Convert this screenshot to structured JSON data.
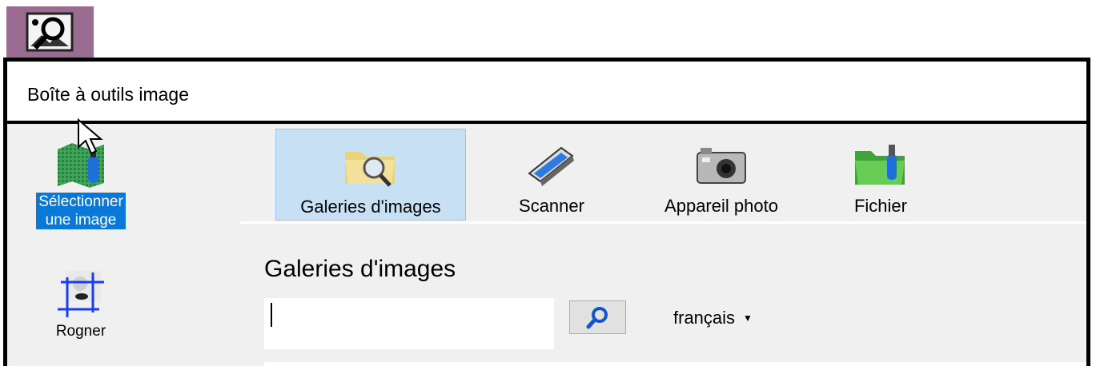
{
  "app": {
    "icon": "image-toolbox-app-icon",
    "accent": "#9b6c91"
  },
  "window": {
    "title": "Boîte à outils image"
  },
  "sidebar": {
    "items": [
      {
        "label_line1": "Sélectionner",
        "label_line2": "une image",
        "icon": "select-image-icon",
        "selected": true
      },
      {
        "label": "Rogner",
        "icon": "crop-icon",
        "selected": false
      }
    ],
    "selected_color": "#0a78d7"
  },
  "tabs": [
    {
      "label": "Galeries d'images",
      "icon": "folder-search-icon",
      "active": true
    },
    {
      "label": "Scanner",
      "icon": "scanner-icon",
      "active": false
    },
    {
      "label": "Appareil photo",
      "icon": "camera-icon",
      "active": false
    },
    {
      "label": "Fichier",
      "icon": "usb-folder-icon",
      "active": false
    }
  ],
  "gallery": {
    "title": "Galeries d'images",
    "search_value": "",
    "search_button_icon": "search-icon",
    "language": "français"
  }
}
